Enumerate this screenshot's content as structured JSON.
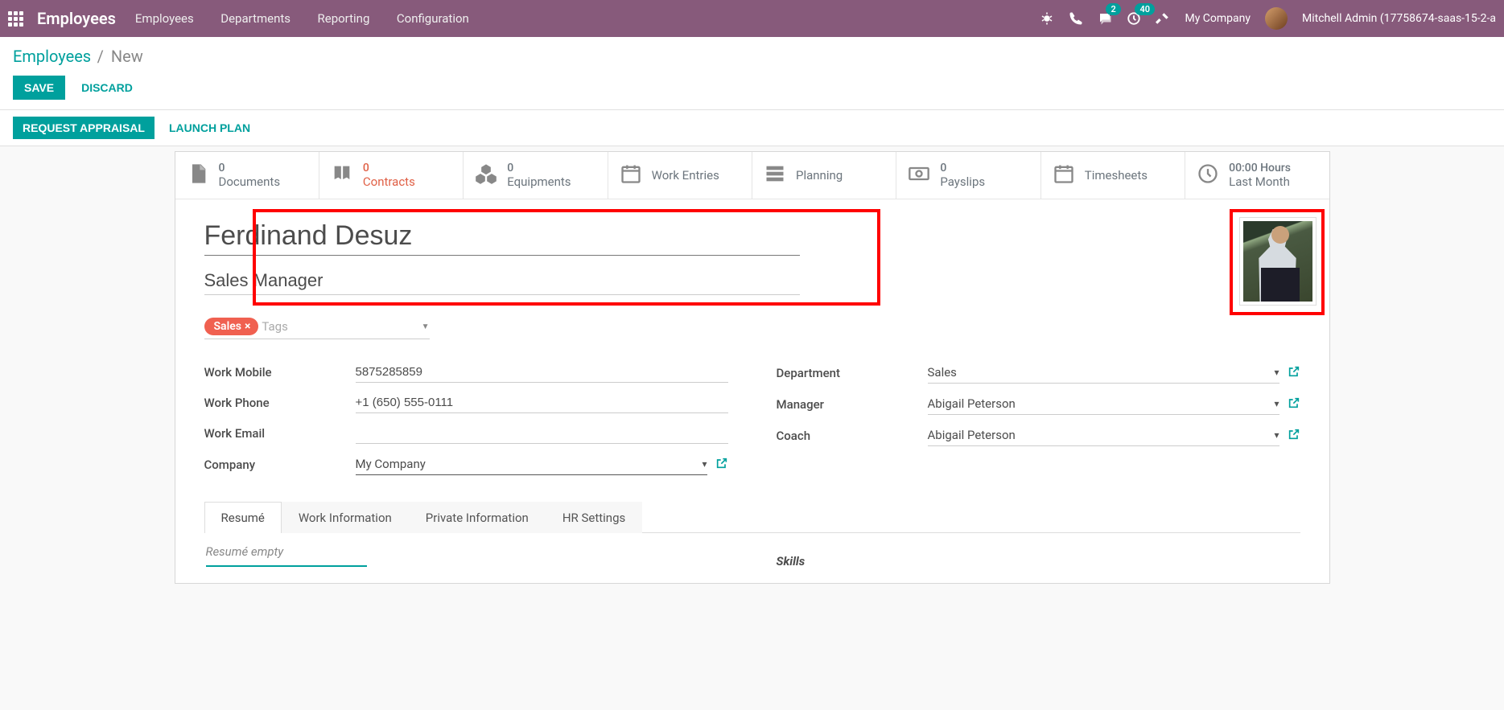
{
  "topbar": {
    "brand": "Employees",
    "nav": [
      "Employees",
      "Departments",
      "Reporting",
      "Configuration"
    ],
    "badge_messages": "2",
    "badge_activities": "40",
    "company": "My Company",
    "user": "Mitchell Admin (17758674-saas-15-2-a"
  },
  "breadcrumb": {
    "root": "Employees",
    "sep": " / ",
    "current": "New"
  },
  "actions": {
    "save": "SAVE",
    "discard": "DISCARD"
  },
  "statusbar": {
    "request": "REQUEST APPRAISAL",
    "launch": "LAUNCH PLAN"
  },
  "stats": {
    "documents": {
      "count": "0",
      "label": "Documents"
    },
    "contracts": {
      "count": "0",
      "label": "Contracts"
    },
    "equipments": {
      "count": "0",
      "label": "Equipments"
    },
    "workentries": {
      "label": "Work Entries"
    },
    "planning": {
      "label": "Planning"
    },
    "payslips": {
      "count": "0",
      "label": "Payslips"
    },
    "timesheets": {
      "label": "Timesheets"
    },
    "hours": {
      "count": "00:00 Hours",
      "label": "Last Month"
    }
  },
  "employee": {
    "name": "Ferdinand Desuz",
    "title": "Sales Manager",
    "tag": "Sales",
    "tags_placeholder": "Tags"
  },
  "labels": {
    "work_mobile": "Work Mobile",
    "work_phone": "Work Phone",
    "work_email": "Work Email",
    "company": "Company",
    "department": "Department",
    "manager": "Manager",
    "coach": "Coach"
  },
  "values": {
    "work_mobile": "5875285859",
    "work_phone": "+1 (650) 555-0111",
    "company": "My Company",
    "department": "Sales",
    "manager": "Abigail Peterson",
    "coach": "Abigail Peterson"
  },
  "tabs": {
    "resume": "Resumé",
    "work_info": "Work Information",
    "private_info": "Private Information",
    "hr_settings": "HR Settings"
  },
  "resume": {
    "empty": "Resumé empty",
    "skills_header": "Skills"
  }
}
